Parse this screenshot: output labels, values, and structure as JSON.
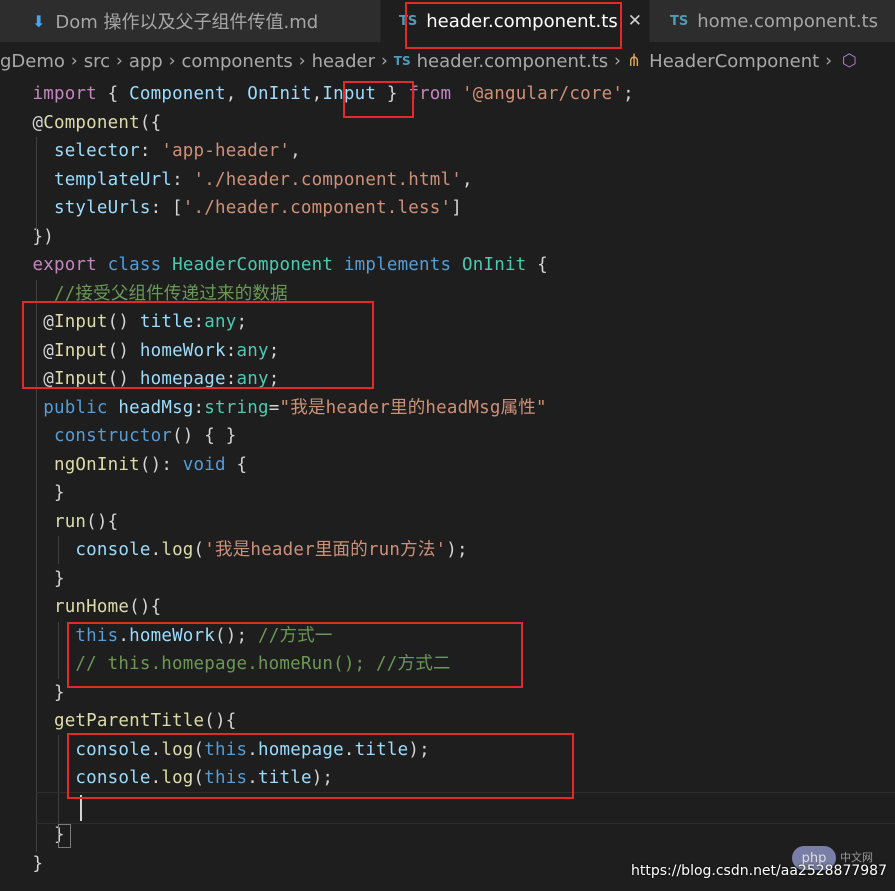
{
  "tabs": [
    {
      "label": "Dom 操作以及父子组件传值.md",
      "icon": "markdown-download-icon"
    },
    {
      "label": "header.component.ts",
      "icon": "ts-icon",
      "active": true
    },
    {
      "label": "home.component.ts",
      "icon": "ts-icon"
    }
  ],
  "tab_close_icon": "close-icon",
  "breadcrumb": {
    "parts": [
      "gDemo",
      "src",
      "app",
      "components",
      "header"
    ],
    "file": "header.component.ts",
    "symbol": "HeaderComponent",
    "file_badge": "TS",
    "symbol_icon": "class-icon",
    "trailing_icon": "cube-icon"
  },
  "ts_badge": "TS",
  "code_lines": [
    [
      {
        "t": "  "
      },
      {
        "t": "import",
        "c": "kw"
      },
      {
        "t": " { "
      },
      {
        "t": "Component",
        "c": "var"
      },
      {
        "t": ", "
      },
      {
        "t": "OnInit",
        "c": "var"
      },
      {
        "t": ","
      },
      {
        "t": "Input",
        "c": "var"
      },
      {
        "t": " } "
      },
      {
        "t": "from",
        "c": "kw"
      },
      {
        "t": " "
      },
      {
        "t": "'@angular/core'",
        "c": "str"
      },
      {
        "t": ";"
      }
    ],
    [
      {
        "t": "  @"
      },
      {
        "t": "Component",
        "c": "fn"
      },
      {
        "t": "({"
      }
    ],
    [
      {
        "t": "    "
      },
      {
        "t": "selector",
        "c": "var"
      },
      {
        "t": ": "
      },
      {
        "t": "'app-header'",
        "c": "str"
      },
      {
        "t": ","
      }
    ],
    [
      {
        "t": "    "
      },
      {
        "t": "templateUrl",
        "c": "var"
      },
      {
        "t": ": "
      },
      {
        "t": "'./header.component.html'",
        "c": "str"
      },
      {
        "t": ","
      }
    ],
    [
      {
        "t": "    "
      },
      {
        "t": "styleUrls",
        "c": "var"
      },
      {
        "t": ": ["
      },
      {
        "t": "'./header.component.less'",
        "c": "str"
      },
      {
        "t": "]"
      }
    ],
    [
      {
        "t": "  })"
      }
    ],
    [
      {
        "t": "  "
      },
      {
        "t": "export",
        "c": "kw"
      },
      {
        "t": " "
      },
      {
        "t": "class",
        "c": "blue"
      },
      {
        "t": " "
      },
      {
        "t": "HeaderComponent",
        "c": "type"
      },
      {
        "t": " "
      },
      {
        "t": "implements",
        "c": "blue"
      },
      {
        "t": " "
      },
      {
        "t": "OnInit",
        "c": "type"
      },
      {
        "t": " {"
      }
    ],
    [
      {
        "t": "    "
      },
      {
        "t": "//接受父组件传递过来的数据",
        "c": "cmt"
      }
    ],
    [
      {
        "t": "   @"
      },
      {
        "t": "Input",
        "c": "fn"
      },
      {
        "t": "() "
      },
      {
        "t": "title",
        "c": "var"
      },
      {
        "t": ":"
      },
      {
        "t": "any",
        "c": "type"
      },
      {
        "t": ";"
      }
    ],
    [
      {
        "t": "   @"
      },
      {
        "t": "Input",
        "c": "fn"
      },
      {
        "t": "() "
      },
      {
        "t": "homeWork",
        "c": "var"
      },
      {
        "t": ":"
      },
      {
        "t": "any",
        "c": "type"
      },
      {
        "t": ";"
      }
    ],
    [
      {
        "t": "   @"
      },
      {
        "t": "Input",
        "c": "fn"
      },
      {
        "t": "() "
      },
      {
        "t": "homepage",
        "c": "var"
      },
      {
        "t": ":"
      },
      {
        "t": "any",
        "c": "type"
      },
      {
        "t": ";"
      }
    ],
    [
      {
        "t": "   "
      },
      {
        "t": "public",
        "c": "blue"
      },
      {
        "t": " "
      },
      {
        "t": "headMsg",
        "c": "var"
      },
      {
        "t": ":"
      },
      {
        "t": "string",
        "c": "type"
      },
      {
        "t": "="
      },
      {
        "t": "\"我是header里的headMsg属性\"",
        "c": "str"
      }
    ],
    [
      {
        "t": "    "
      },
      {
        "t": "constructor",
        "c": "blue"
      },
      {
        "t": "() { }"
      }
    ],
    [
      {
        "t": "    "
      },
      {
        "t": "ngOnInit",
        "c": "fn"
      },
      {
        "t": "(): "
      },
      {
        "t": "void",
        "c": "blue"
      },
      {
        "t": " {"
      }
    ],
    [
      {
        "t": "    }"
      }
    ],
    [
      {
        "t": "    "
      },
      {
        "t": "run",
        "c": "fn"
      },
      {
        "t": "(){"
      }
    ],
    [
      {
        "t": "      "
      },
      {
        "t": "console",
        "c": "var"
      },
      {
        "t": "."
      },
      {
        "t": "log",
        "c": "fn"
      },
      {
        "t": "("
      },
      {
        "t": "'我是header里面的run方法'",
        "c": "str"
      },
      {
        "t": ");"
      }
    ],
    [
      {
        "t": "    }"
      }
    ],
    [
      {
        "t": "    "
      },
      {
        "t": "runHome",
        "c": "fn"
      },
      {
        "t": "(){"
      }
    ],
    [
      {
        "t": "      "
      },
      {
        "t": "this",
        "c": "blue"
      },
      {
        "t": "."
      },
      {
        "t": "homeWork",
        "c": "var"
      },
      {
        "t": "(); "
      },
      {
        "t": "//方式一",
        "c": "cmt"
      }
    ],
    [
      {
        "t": "      "
      },
      {
        "t": "// this.homepage.homeRun(); //方式二",
        "c": "cmt"
      }
    ],
    [
      {
        "t": "    }"
      }
    ],
    [
      {
        "t": "    "
      },
      {
        "t": "getParentTitle",
        "c": "fn"
      },
      {
        "t": "(){"
      }
    ],
    [
      {
        "t": "      "
      },
      {
        "t": "console",
        "c": "var"
      },
      {
        "t": "."
      },
      {
        "t": "log",
        "c": "fn"
      },
      {
        "t": "("
      },
      {
        "t": "this",
        "c": "blue"
      },
      {
        "t": "."
      },
      {
        "t": "homepage",
        "c": "var"
      },
      {
        "t": "."
      },
      {
        "t": "title",
        "c": "var"
      },
      {
        "t": ");"
      }
    ],
    [
      {
        "t": "      "
      },
      {
        "t": "console",
        "c": "var"
      },
      {
        "t": "."
      },
      {
        "t": "log",
        "c": "fn"
      },
      {
        "t": "("
      },
      {
        "t": "this",
        "c": "blue"
      },
      {
        "t": "."
      },
      {
        "t": "title",
        "c": "var"
      },
      {
        "t": ");"
      }
    ],
    [
      {
        "t": ""
      }
    ],
    [
      {
        "t": "    }"
      }
    ],
    [
      {
        "t": "  }"
      }
    ]
  ],
  "syntax_colors": {
    "kw": "#c586c0",
    "blue": "#569cd6",
    "fn": "#dcdcaa",
    "var": "#9cdcfe",
    "str": "#ce9178",
    "type": "#4ec9b0",
    "cmt": "#6a9955",
    "plain": "#d4d4d4"
  },
  "highlight_color": "#e22a2a",
  "watermark": "https://blog.csdn.net/aa2528877987",
  "logo_text": "php",
  "logo_sub": "中文网"
}
